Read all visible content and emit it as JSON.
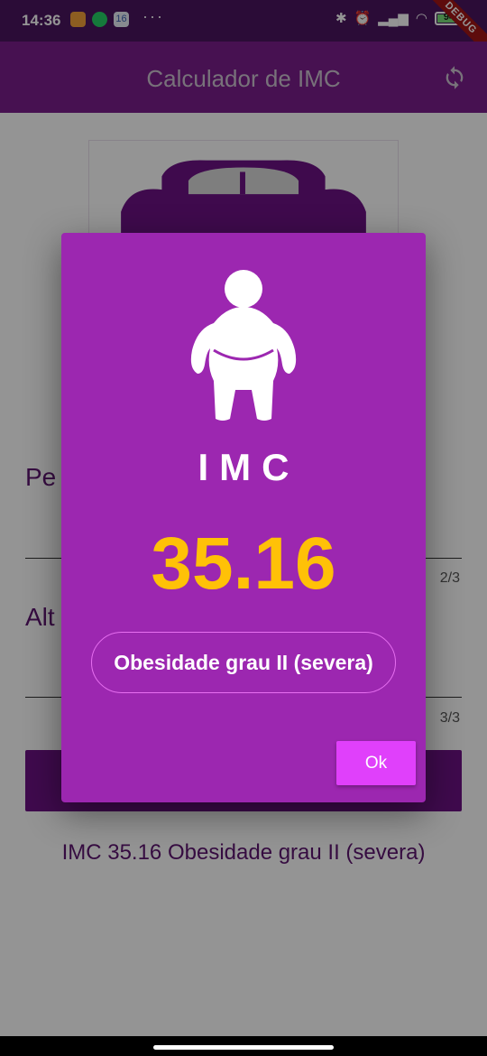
{
  "status_bar": {
    "time": "14:36",
    "notification_badge": "16",
    "more": "···",
    "battery_level": "94",
    "debug_banner": "DEBUG"
  },
  "app_bar": {
    "title": "Calculador de IMC",
    "refresh_icon": "refresh-icon"
  },
  "form": {
    "weight_label": "Pe",
    "weight_counter": "2/3",
    "height_label": "Alt",
    "height_counter": "3/3"
  },
  "result_text": "IMC 35.16 Obesidade grau II (severa)",
  "dialog": {
    "title": "IMC",
    "value": "35.16",
    "category": "Obesidade grau II (severa)",
    "ok_label": "Ok",
    "icon": "obese-person-icon"
  },
  "colors": {
    "app_bar": "#7a1e8c",
    "dialog_bg": "#9c27b0",
    "value_color": "#ffc107",
    "ok_button": "#e040fb"
  }
}
